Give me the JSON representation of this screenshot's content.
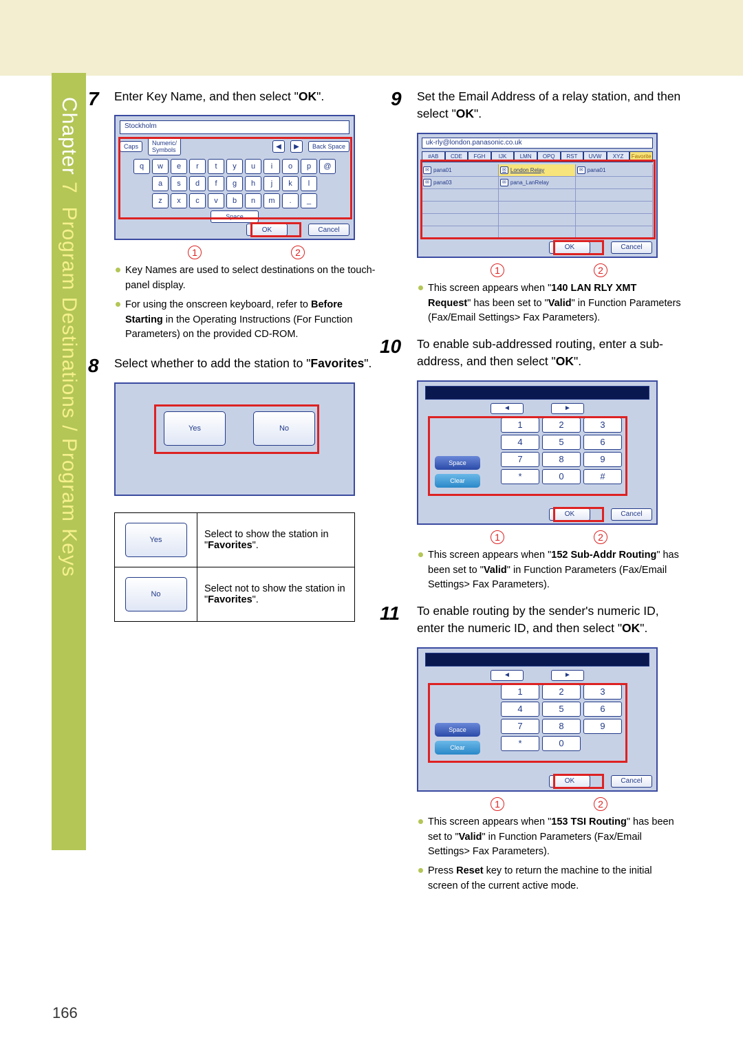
{
  "page_number": "166",
  "chapter_label": "Chapter",
  "chapter_num": "7",
  "chapter_title": "Program Destinations / Program Keys",
  "steps": {
    "s7": {
      "num": "7",
      "text_a": "Enter Key Name, and then select \"",
      "bold": "OK",
      "text_b": "\"."
    },
    "s8": {
      "num": "8",
      "text_a": "Select whether to add the station to \"",
      "bold": "Favorites",
      "text_b": "\"."
    },
    "s9": {
      "num": "9",
      "text_a": "Set the Email Address of a relay station, and then select \"",
      "bold": "OK",
      "text_b": "\"."
    },
    "s10": {
      "num": "10",
      "text_a": "To enable sub-addressed routing, enter a sub-address, and then select \"",
      "bold": "OK",
      "text_b": "\"."
    },
    "s11": {
      "num": "11",
      "text_a": "To enable routing by the sender's numeric ID, enter the numeric ID, and then select \"",
      "bold": "OK",
      "text_b": "\"."
    }
  },
  "bullets": {
    "b7a": "Key Names are used to select destinations on the touch-panel display.",
    "b7b_a": "For using the onscreen keyboard, refer to ",
    "b7b_bold": "Before Starting",
    "b7b_b": " in the Operating Instructions (For Function Parameters) on the provided CD-ROM.",
    "b9_a": "This screen appears when \"",
    "b9_bold": "140 LAN RLY XMT Request",
    "b9_b": "\" has been set to \"",
    "b9_bold2": "Valid",
    "b9_c": "\" in Function Parameters (Fax/Email Settings> Fax Parameters).",
    "b10_a": "This screen appears when \"",
    "b10_bold": "152 Sub-Addr Routing",
    "b10_b": "\" has been set to \"",
    "b10_bold2": "Valid",
    "b10_c": "\" in Function Parameters (Fax/Email Settings> Fax Parameters).",
    "b11a_a": "This screen appears when \"",
    "b11a_bold": "153 TSI Routing",
    "b11a_b": "\" has been set to \"",
    "b11a_bold2": "Valid",
    "b11a_c": "\" in Function Parameters (Fax/Email Settings> Fax Parameters).",
    "b11b_a": "Press ",
    "b11b_bold": "Reset",
    "b11b_b": " key to return the machine to the initial screen of the current active mode."
  },
  "callout": {
    "one": "1",
    "two": "2"
  },
  "kbd": {
    "title": "Stockholm",
    "caps": "Caps",
    "numsym": "Numeric/\nSymbols",
    "backspace": "Back Space",
    "row1": [
      "q",
      "w",
      "e",
      "r",
      "t",
      "y",
      "u",
      "i",
      "o",
      "p",
      "@"
    ],
    "row2": [
      "a",
      "s",
      "d",
      "f",
      "g",
      "h",
      "j",
      "k",
      "l"
    ],
    "row3": [
      "z",
      "x",
      "c",
      "v",
      "b",
      "n",
      "m",
      ".",
      "_"
    ],
    "space": "Space",
    "ok": "OK",
    "cancel": "Cancel"
  },
  "yn": {
    "yes": "Yes",
    "no": "No",
    "yes_desc_a": "Select to show the station in \"",
    "yes_desc_b": "Favorites",
    "yes_desc_c": "\".",
    "no_desc_a": "Select not to show the station in \"",
    "no_desc_b": "Favorites",
    "no_desc_c": "\"."
  },
  "email": {
    "addr": "uk-rly@london.panasonic.co.uk",
    "tabs": [
      "#AB",
      "CDE",
      "FGH",
      "IJK",
      "LMN",
      "OPQ",
      "RST",
      "UVW",
      "XYZ",
      "Favorite"
    ],
    "cells": [
      [
        "pana01",
        "London Relay",
        "pana01"
      ],
      [
        "pana03",
        "pana_LanRelay",
        ""
      ]
    ],
    "ok": "OK",
    "cancel": "Cancel"
  },
  "numpad": {
    "keys_r1": [
      "1",
      "2",
      "3"
    ],
    "keys_r2": [
      "4",
      "5",
      "6"
    ],
    "keys_r3": [
      "7",
      "8",
      "9"
    ],
    "keys_r4a": [
      "*",
      "0",
      "#"
    ],
    "keys_r4b": [
      "*",
      "0"
    ],
    "space": "Space",
    "clear": "Clear",
    "ok": "OK",
    "cancel": "Cancel"
  }
}
